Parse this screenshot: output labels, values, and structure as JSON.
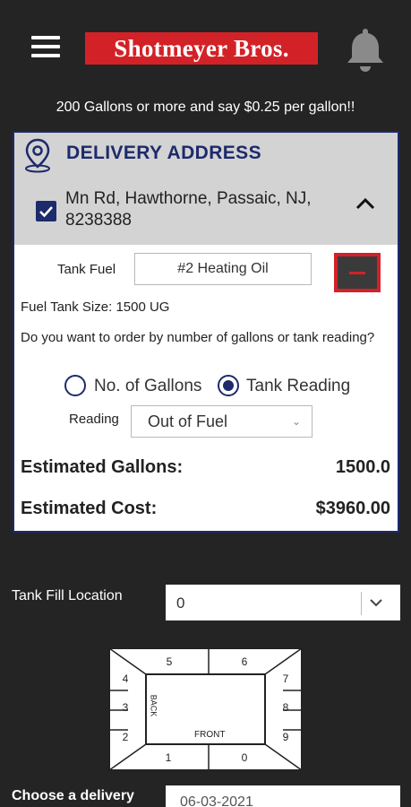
{
  "header": {
    "brand": "Shotmeyer Bros.",
    "menu_icon": "hamburger-menu-icon",
    "notification_icon": "bell-icon"
  },
  "promo": "200 Gallons or more and say $0.25 per gallon!!",
  "delivery": {
    "title": "DELIVERY ADDRESS",
    "address": "Mn Rd, Hawthorne, Passaic, NJ, 8238388",
    "address_checked": true,
    "tank_fuel_label": "Tank Fuel",
    "tank_fuel_value": "#2 Heating Oil",
    "tank_size": "Fuel Tank Size: 1500 UG",
    "order_question": "Do you want to order by number of gallons or tank reading?",
    "option_gallons": "No. of Gallons",
    "option_reading": "Tank Reading",
    "selected_option": "Tank Reading",
    "reading_label": "Reading",
    "reading_value": "Out of Fuel",
    "est_gallons_label": "Estimated Gallons:",
    "est_gallons_value": "1500.0",
    "est_cost_label": "Estimated Cost:",
    "est_cost_value": "$3960.00"
  },
  "tank_fill": {
    "label": "Tank Fill Location",
    "value": "0",
    "positions": [
      "5",
      "6",
      "4",
      "7",
      "3",
      "8",
      "2",
      "9",
      "1",
      "0"
    ],
    "front_label": "FRONT",
    "back_label": "BACK"
  },
  "delivery_date": {
    "label": "Choose a delivery",
    "value": "06-03-2021"
  },
  "colors": {
    "background": "#242424",
    "brand_red": "#d32227",
    "navy": "#1d2a6b"
  }
}
